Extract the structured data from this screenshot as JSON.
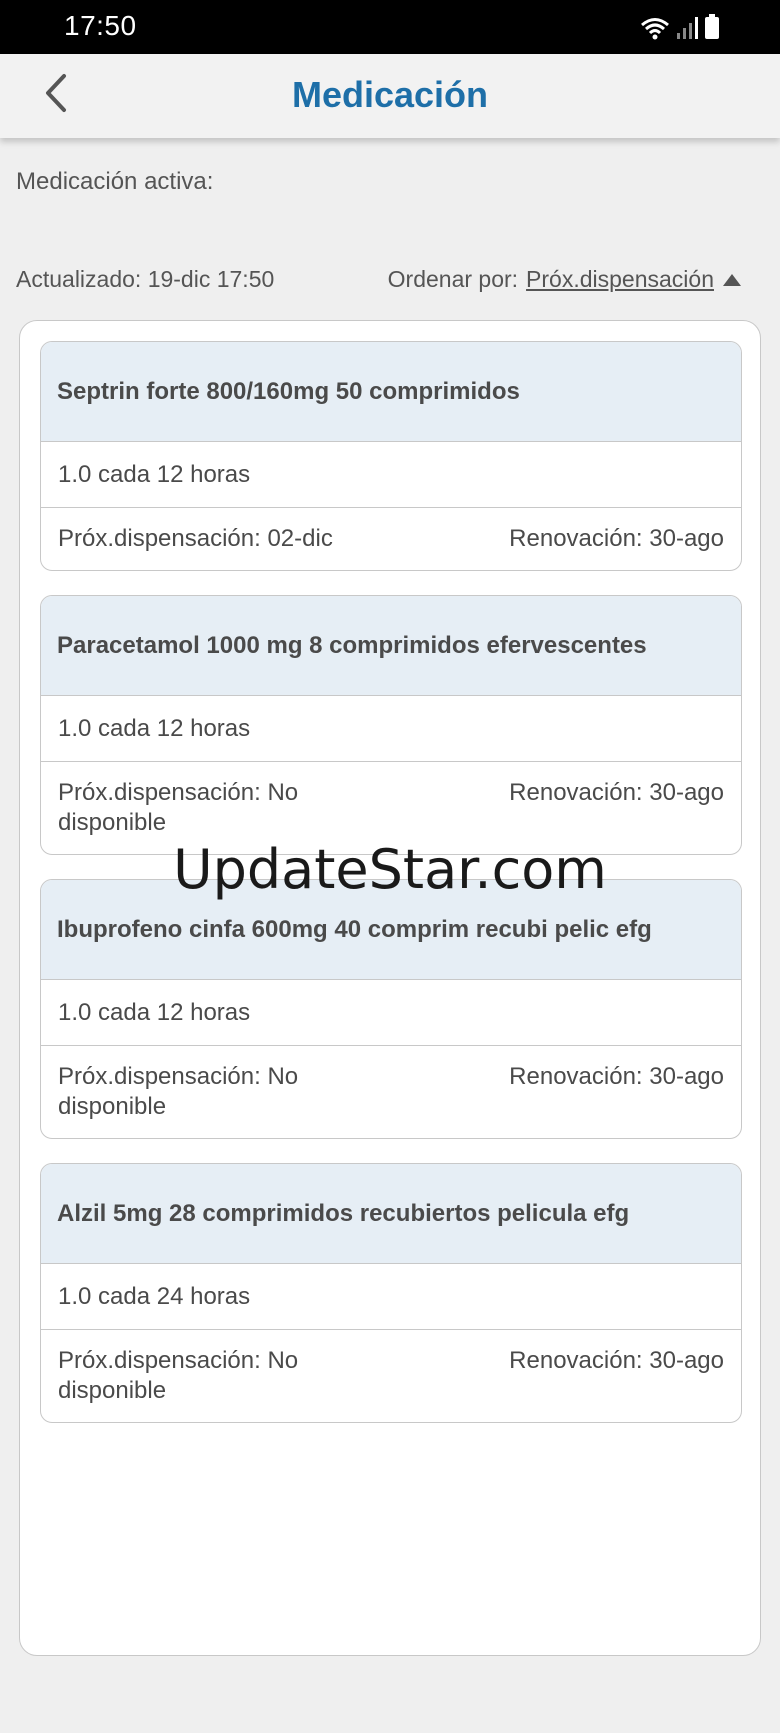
{
  "status_bar": {
    "time": "17:50"
  },
  "header": {
    "title": "Medicación"
  },
  "section_label": "Medicación activa:",
  "meta": {
    "updated": "Actualizado: 19-dic 17:50",
    "sort_label": "Ordenar por:",
    "sort_value": "Próx.dispensación"
  },
  "medications": [
    {
      "name": "Septrin forte 800/160mg 50 comprimidos",
      "dose": "1.0 cada 12 horas",
      "next_dispensation": "Próx.dispensación: 02-dic",
      "renewal": "Renovación: 30-ago"
    },
    {
      "name": "Paracetamol 1000 mg 8 comprimidos efervescentes",
      "dose": "1.0 cada 12 horas",
      "next_dispensation": "Próx.dispensación: No disponible",
      "renewal": "Renovación: 30-ago"
    },
    {
      "name": "Ibuprofeno cinfa 600mg 40 comprim recubi pelic efg",
      "dose": "1.0 cada 12 horas",
      "next_dispensation": "Próx.dispensación: No disponible",
      "renewal": "Renovación: 30-ago"
    },
    {
      "name": "Alzil 5mg 28 comprimidos recubiertos pelicula efg",
      "dose": "1.0 cada 24 horas",
      "next_dispensation": "Próx.dispensación: No disponible",
      "renewal": "Renovación: 30-ago"
    }
  ],
  "watermark": "UpdateStar.com",
  "colors": {
    "accent": "#1e6fa8",
    "card_header": "#e6eef5",
    "border": "#c8c8c8"
  },
  "icons": {
    "back": "chevron-left-icon",
    "sort": "triangle-up-icon",
    "wifi": "wifi-icon",
    "signal": "signal-icon",
    "battery": "battery-icon"
  }
}
